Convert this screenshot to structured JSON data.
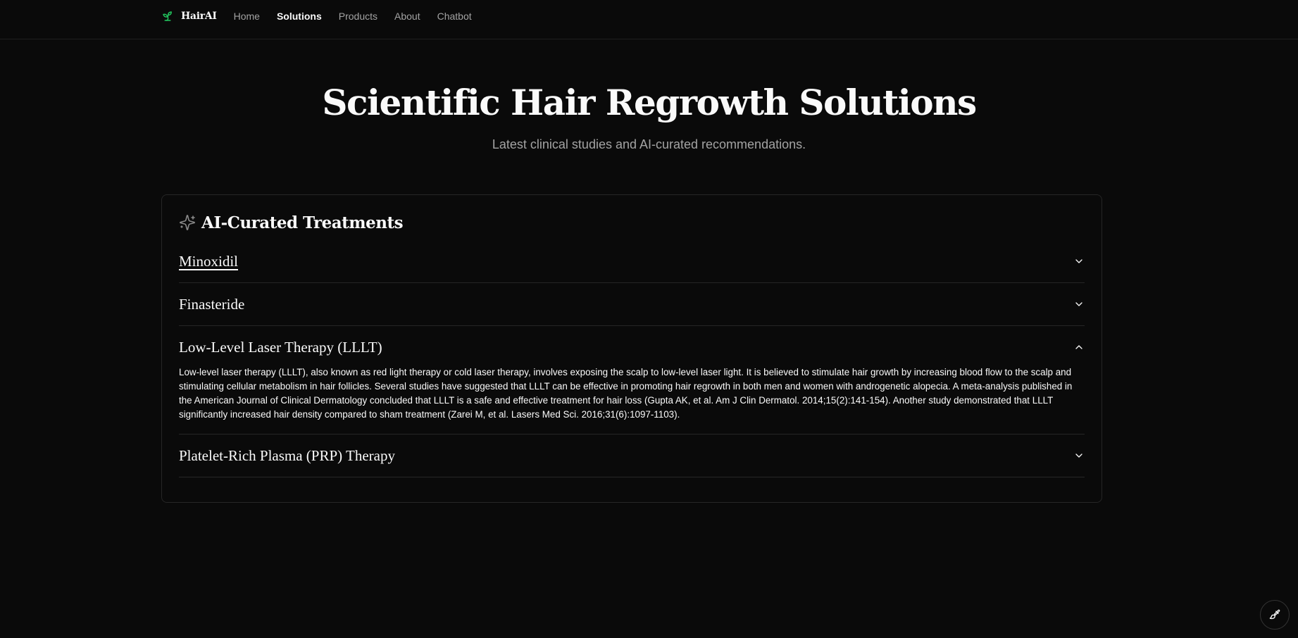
{
  "nav": {
    "brand": "HairAI",
    "links": [
      "Home",
      "Solutions",
      "Products",
      "About",
      "Chatbot"
    ],
    "active": "Solutions"
  },
  "hero": {
    "title": "Scientific Hair Regrowth Solutions",
    "subtitle": "Latest clinical studies and AI-curated recommendations."
  },
  "card": {
    "title": "AI-Curated Treatments",
    "items": [
      {
        "label": "Minoxidil",
        "expanded": false
      },
      {
        "label": "Finasteride",
        "expanded": false
      },
      {
        "label": "Low-Level Laser Therapy (LLLT)",
        "expanded": true,
        "content": "Low-level laser therapy (LLLT), also known as red light therapy or cold laser therapy, involves exposing the scalp to low-level laser light. It is believed to stimulate hair growth by increasing blood flow to the scalp and stimulating cellular metabolism in hair follicles. Several studies have suggested that LLLT can be effective in promoting hair regrowth in both men and women with androgenetic alopecia. A meta-analysis published in the American Journal of Clinical Dermatology concluded that LLLT is a safe and effective treatment for hair loss (Gupta AK, et al. Am J Clin Dermatol. 2014;15(2):141-154). Another study demonstrated that LLLT significantly increased hair density compared to sham treatment (Zarei M, et al. Lasers Med Sci. 2016;31(6):1097-1103)."
      },
      {
        "label": "Platelet-Rich Plasma (PRP) Therapy",
        "expanded": false
      }
    ]
  },
  "icons": {
    "brand": "sprout-icon",
    "card": "sparkles-icon",
    "collapsed": "chevron-down-icon",
    "expanded": "chevron-up-icon",
    "fab": "paintbrush-icon"
  },
  "colors": {
    "background": "#0a0a0a",
    "brand_accent": "#22c55e",
    "border": "#262626",
    "muted_text": "#a3a3a3"
  }
}
